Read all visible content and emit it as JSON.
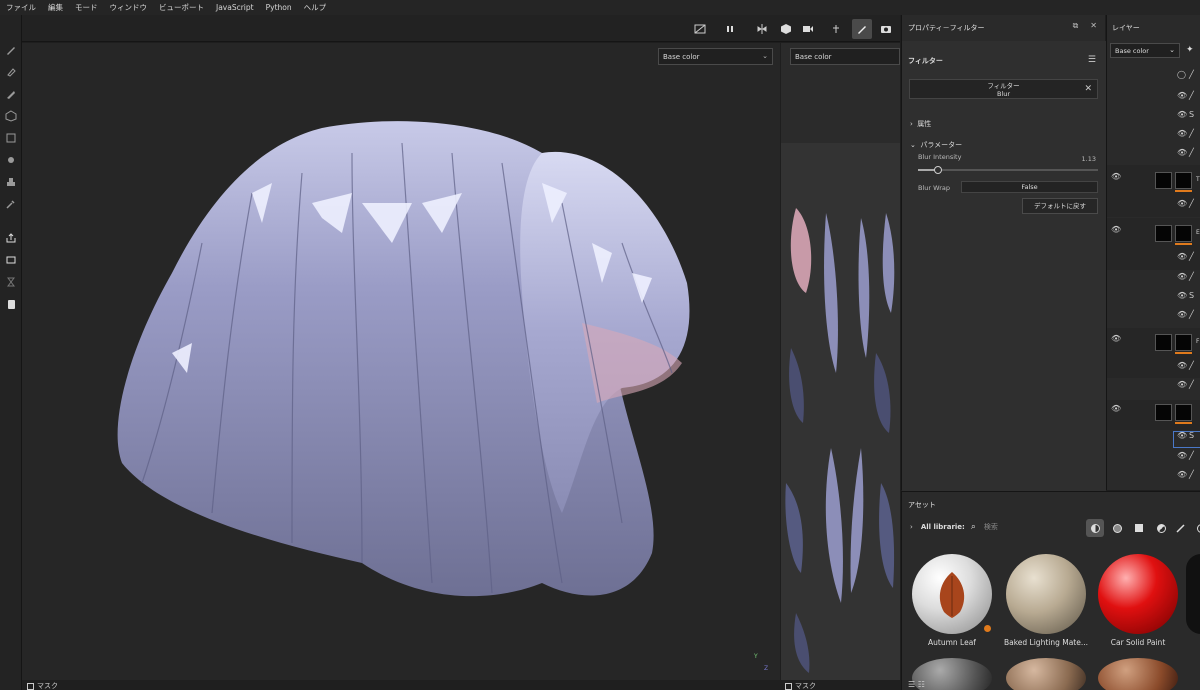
{
  "menu": [
    "ファイル",
    "編集",
    "モード",
    "ウィンドウ",
    "ビューポート",
    "JavaScript",
    "Python",
    "ヘルプ"
  ],
  "viewport": {
    "channel_left": "Base color",
    "channel_right": "Base color",
    "mask_left": "マスク",
    "mask_right": "マスク",
    "axis_y": "Y",
    "axis_z": "Z"
  },
  "properties": {
    "title": "プロパティ－フィルター",
    "section": "フィルター",
    "filter_label": "フィルター",
    "filter_name": "Blur",
    "attributes": "属性",
    "parameters": "パラメーター",
    "blur_intensity_label": "Blur Intensity",
    "blur_intensity_value": "1.13",
    "blur_intensity_fraction": 0.11,
    "blur_wrap_label": "Blur Wrap",
    "blur_wrap_value": "False",
    "reset_button": "デフォルトに戻す"
  },
  "layers": {
    "title": "レイヤー",
    "channel": "Base color",
    "initials": [
      "T",
      "E",
      "F"
    ]
  },
  "assets": {
    "title": "アセット",
    "library": "All librarie:",
    "search_placeholder": "検索",
    "items": [
      {
        "name": "Autumn Leaf"
      },
      {
        "name": "Baked Lighting Mate..."
      },
      {
        "name": "Car Solid Paint"
      }
    ]
  },
  "colors": {
    "accent_orange": "#e07a1c",
    "selection_blue": "#4a78c8",
    "hair_base": "#9ea0c8"
  }
}
